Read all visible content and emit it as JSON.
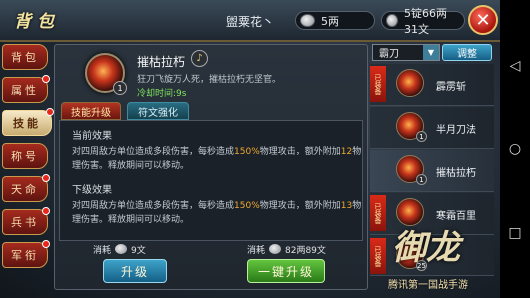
{
  "header": {
    "title": "背包",
    "player_name": "盥粟花丶",
    "silver": "5两",
    "gold": "5锭66两31文"
  },
  "left_nav": [
    {
      "label": "背包",
      "dot": false,
      "active": false
    },
    {
      "label": "属性",
      "dot": true,
      "active": false
    },
    {
      "label": "技能",
      "dot": true,
      "active": true
    },
    {
      "label": "称号",
      "dot": false,
      "active": false
    },
    {
      "label": "天命",
      "dot": true,
      "active": false
    },
    {
      "label": "兵书",
      "dot": true,
      "active": false
    },
    {
      "label": "军衔",
      "dot": true,
      "active": false
    }
  ],
  "skill": {
    "name": "摧枯拉朽",
    "level": "1",
    "description": "狂刀飞旋万人死，摧枯拉朽无坚官。",
    "cooldown": "冷却时间:9s"
  },
  "tabs": {
    "active": "技能升级",
    "inactive": "符文强化"
  },
  "current_effect": {
    "title": "当前效果",
    "text_before": "对四周敌方单位造成多段伤害，每秒造成",
    "percent": "150%",
    "text_mid": "物理攻击，额外附加",
    "bonus": "12",
    "text_after": "物理伤害。释放期间可以移动。"
  },
  "next_effect": {
    "title": "下级效果",
    "text_before": "对四周敌方单位造成多段伤害，每秒造成",
    "percent": "150%",
    "text_mid": "物理攻击，额外附加",
    "bonus": "13",
    "text_after": "物理伤害。释放期间可以移动。"
  },
  "cost": {
    "label": "消耗",
    "upgrade_cost": "9文",
    "onekey_cost": "82两89文"
  },
  "buttons": {
    "upgrade": "升级",
    "onekey_upgrade": "一键升级",
    "adjust": "调整"
  },
  "weapon_select": "霸刀",
  "skill_list": [
    {
      "name": "霹雳斩",
      "ribbon": "已装备",
      "level": "",
      "selected": false
    },
    {
      "name": "半月刀法",
      "ribbon": "",
      "level": "1",
      "selected": false
    },
    {
      "name": "摧枯拉朽",
      "ribbon": "",
      "level": "1",
      "selected": true
    },
    {
      "name": "寒霜百里",
      "ribbon": "已装备",
      "level": "",
      "selected": false
    },
    {
      "name": "",
      "ribbon": "已装备",
      "level": "25",
      "selected": false
    }
  ],
  "logo": {
    "text": "御龙",
    "subtitle": "腾讯第一国战手游"
  },
  "colors": {
    "accent_red": "#b23422",
    "accent_blue": "#3ea3c9",
    "accent_green": "#63c53e",
    "highlight_orange": "#f0a830",
    "cooldown_green": "#7fe35f"
  }
}
